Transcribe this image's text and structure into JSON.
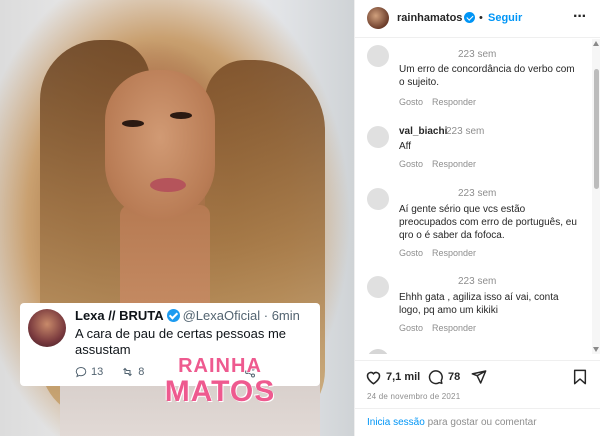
{
  "post": {
    "tweet": {
      "name": "Lexa // BRUTA",
      "handle": "@LexaOficial",
      "time": "· 6min",
      "text": "A cara de pau de certas pessoas me assustam",
      "replies": "13",
      "retweets": "8"
    },
    "watermark": {
      "line1": "RAINHA",
      "line2": "MATOS"
    }
  },
  "header": {
    "username": "rainhamatos",
    "separator": "•",
    "follow_label": "Seguir",
    "more_label": "···"
  },
  "comments": [
    {
      "user": "",
      "time": "223 sem",
      "text": "Um erro de concordância do verbo com o sujeito.",
      "like": "Gosto",
      "reply": "Responder"
    },
    {
      "user": "val_biachi",
      "time": "223 sem",
      "text": "Aff",
      "like": "Gosto",
      "reply": "Responder"
    },
    {
      "user": "",
      "time": "223 sem",
      "text": "Aí gente sério que vcs estão preocupados com erro de português, eu qro o é saber da fofoca.",
      "like": "Gosto",
      "reply": "Responder"
    },
    {
      "user": "",
      "time": "223 sem",
      "text": "Ehhh gata , agiliza isso aí vai, conta logo, pq amo um kikiki",
      "like": "Gosto",
      "reply": "Responder"
    }
  ],
  "actions": {
    "likes": "7,1 mil",
    "comments": "78"
  },
  "date": "24 de novembro de 2021",
  "login": {
    "link": "Inicia sessão",
    "text": " para gostar ou comentar"
  }
}
